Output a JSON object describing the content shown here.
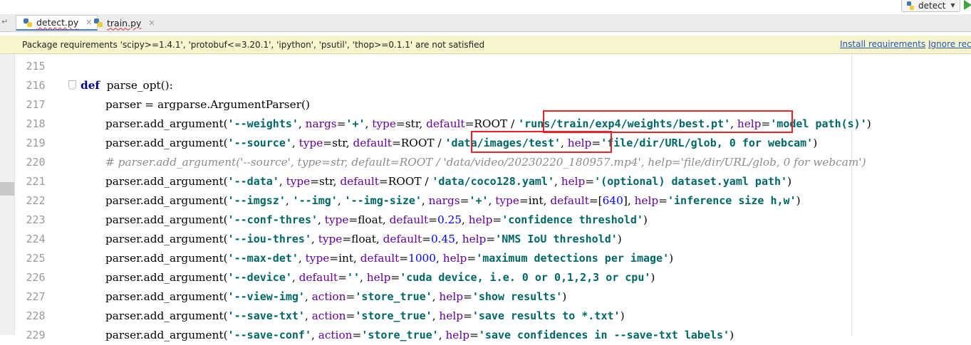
{
  "tabs": [
    {
      "label": "detect.py",
      "active": true
    },
    {
      "label": "train.py",
      "active": false
    }
  ],
  "tab_nav_icon": "tab-list-icon",
  "run_config": {
    "label": "detect",
    "icon": "python-file-icon"
  },
  "banner": {
    "message": "Package requirements 'scipy>=1.4.1', 'protobuf<=3.20.1', 'ipython', 'psutil', 'thop>=0.1.1' are not satisfied",
    "install_link": "Install requirements",
    "ignore_link": "Ignore rec"
  },
  "colors": {
    "keyword": "#000080",
    "string": "#006666",
    "kwarg": "#660099",
    "number": "#0000ff",
    "comment": "#8c8c8c",
    "highlight_box": "#e8232a",
    "banner_bg": "#f7f5cb"
  },
  "code_lines": [
    {
      "number": "215",
      "tokens": []
    },
    {
      "number": "216",
      "tokens": [
        [
          "kw",
          "def"
        ],
        [
          "",
          "  parse_opt():"
        ]
      ]
    },
    {
      "number": "217",
      "tokens": [
        [
          "",
          "    parser = argparse.ArgumentParser()"
        ]
      ]
    },
    {
      "number": "218",
      "tokens": [
        [
          "",
          "    parser.add_argument("
        ],
        [
          "str",
          "'--weights'"
        ],
        [
          "",
          ", "
        ],
        [
          "kwarg",
          "nargs"
        ],
        [
          "",
          "="
        ],
        [
          "str",
          "'+'"
        ],
        [
          "",
          ", "
        ],
        [
          "kwarg",
          "type"
        ],
        [
          "",
          "=str, "
        ],
        [
          "kwarg",
          "default"
        ],
        [
          "",
          "=ROOT / "
        ],
        [
          "str",
          "'runs/train/exp4/weights/best.pt'"
        ],
        [
          "",
          ", "
        ],
        [
          "kwarg",
          "help"
        ],
        [
          "",
          "="
        ],
        [
          "str",
          "'model path(s)'"
        ],
        [
          "",
          ")"
        ]
      ]
    },
    {
      "number": "219",
      "tokens": [
        [
          "",
          "    parser.add_argument("
        ],
        [
          "str",
          "'--source'"
        ],
        [
          "",
          ", "
        ],
        [
          "kwarg",
          "type"
        ],
        [
          "",
          "=str, "
        ],
        [
          "kwarg",
          "default"
        ],
        [
          "",
          "=ROOT / "
        ],
        [
          "str",
          "'data/images/test'"
        ],
        [
          "",
          ", "
        ],
        [
          "kwarg",
          "help"
        ],
        [
          "",
          "="
        ],
        [
          "str",
          "'file/dir/URL/glob, 0 for webcam'"
        ],
        [
          "",
          ")"
        ]
      ]
    },
    {
      "number": "220",
      "tokens": [
        [
          "",
          "    "
        ],
        [
          "cmt",
          "# parser.add_argument('--source', type=str, default=ROOT / 'data/video/20230220_180957.mp4', help='file/dir/URL/glob, 0 for webcam')"
        ]
      ]
    },
    {
      "number": "221",
      "tokens": [
        [
          "",
          "    parser.add_argument("
        ],
        [
          "str",
          "'--data'"
        ],
        [
          "",
          ", "
        ],
        [
          "kwarg",
          "type"
        ],
        [
          "",
          "=str, "
        ],
        [
          "kwarg",
          "default"
        ],
        [
          "",
          "=ROOT / "
        ],
        [
          "str",
          "'data/coco128.yaml'"
        ],
        [
          "",
          ", "
        ],
        [
          "kwarg",
          "help"
        ],
        [
          "",
          "="
        ],
        [
          "str",
          "'(optional) dataset.yaml path'"
        ],
        [
          "",
          ")"
        ]
      ]
    },
    {
      "number": "222",
      "tokens": [
        [
          "",
          "    parser.add_argument("
        ],
        [
          "str",
          "'--imgsz'"
        ],
        [
          "",
          ", "
        ],
        [
          "str",
          "'--img'"
        ],
        [
          "",
          ", "
        ],
        [
          "str",
          "'--img-size'"
        ],
        [
          "",
          ", "
        ],
        [
          "kwarg",
          "nargs"
        ],
        [
          "",
          "="
        ],
        [
          "str",
          "'+'"
        ],
        [
          "",
          ", "
        ],
        [
          "kwarg",
          "type"
        ],
        [
          "",
          "=int, "
        ],
        [
          "kwarg",
          "default"
        ],
        [
          "",
          "=["
        ],
        [
          "num",
          "640"
        ],
        [
          "",
          "], "
        ],
        [
          "kwarg",
          "help"
        ],
        [
          "",
          "="
        ],
        [
          "str",
          "'inference size h,w'"
        ],
        [
          "",
          ")"
        ]
      ]
    },
    {
      "number": "223",
      "tokens": [
        [
          "",
          "    parser.add_argument("
        ],
        [
          "str",
          "'--conf-thres'"
        ],
        [
          "",
          ", "
        ],
        [
          "kwarg",
          "type"
        ],
        [
          "",
          "=float, "
        ],
        [
          "kwarg",
          "default"
        ],
        [
          "",
          "="
        ],
        [
          "num",
          "0.25"
        ],
        [
          "",
          ", "
        ],
        [
          "kwarg",
          "help"
        ],
        [
          "",
          "="
        ],
        [
          "str",
          "'confidence threshold'"
        ],
        [
          "",
          ")"
        ]
      ]
    },
    {
      "number": "224",
      "tokens": [
        [
          "",
          "    parser.add_argument("
        ],
        [
          "str",
          "'--iou-thres'"
        ],
        [
          "",
          ", "
        ],
        [
          "kwarg",
          "type"
        ],
        [
          "",
          "=float, "
        ],
        [
          "kwarg",
          "default"
        ],
        [
          "",
          "="
        ],
        [
          "num",
          "0.45"
        ],
        [
          "",
          ", "
        ],
        [
          "kwarg",
          "help"
        ],
        [
          "",
          "="
        ],
        [
          "str",
          "'NMS IoU threshold'"
        ],
        [
          "",
          ")"
        ]
      ]
    },
    {
      "number": "225",
      "tokens": [
        [
          "",
          "    parser.add_argument("
        ],
        [
          "str",
          "'--max-det'"
        ],
        [
          "",
          ", "
        ],
        [
          "kwarg",
          "type"
        ],
        [
          "",
          "=int, "
        ],
        [
          "kwarg",
          "default"
        ],
        [
          "",
          "="
        ],
        [
          "num",
          "1000"
        ],
        [
          "",
          ", "
        ],
        [
          "kwarg",
          "help"
        ],
        [
          "",
          "="
        ],
        [
          "str",
          "'maximum detections per image'"
        ],
        [
          "",
          ")"
        ]
      ]
    },
    {
      "number": "226",
      "tokens": [
        [
          "",
          "    parser.add_argument("
        ],
        [
          "str",
          "'--device'"
        ],
        [
          "",
          ", "
        ],
        [
          "kwarg",
          "default"
        ],
        [
          "",
          "="
        ],
        [
          "str",
          "''"
        ],
        [
          "",
          ", "
        ],
        [
          "kwarg",
          "help"
        ],
        [
          "",
          "="
        ],
        [
          "str",
          "'cuda device, i.e. 0 or 0,1,2,3 or cpu'"
        ],
        [
          "",
          ")"
        ]
      ]
    },
    {
      "number": "227",
      "tokens": [
        [
          "",
          "    parser.add_argument("
        ],
        [
          "str",
          "'--view-img'"
        ],
        [
          "",
          ", "
        ],
        [
          "kwarg",
          "action"
        ],
        [
          "",
          "="
        ],
        [
          "str",
          "'store_true'"
        ],
        [
          "",
          ", "
        ],
        [
          "kwarg",
          "help"
        ],
        [
          "",
          "="
        ],
        [
          "str",
          "'show results'"
        ],
        [
          "",
          ")"
        ]
      ]
    },
    {
      "number": "228",
      "tokens": [
        [
          "",
          "    parser.add_argument("
        ],
        [
          "str",
          "'--save-txt'"
        ],
        [
          "",
          ", "
        ],
        [
          "kwarg",
          "action"
        ],
        [
          "",
          "="
        ],
        [
          "str",
          "'store_true'"
        ],
        [
          "",
          ", "
        ],
        [
          "kwarg",
          "help"
        ],
        [
          "",
          "="
        ],
        [
          "str",
          "'save results to *.txt'"
        ],
        [
          "",
          ")"
        ]
      ]
    },
    {
      "number": "229",
      "tokens": [
        [
          "",
          "    parser.add_argument("
        ],
        [
          "str",
          "'--save-conf'"
        ],
        [
          "",
          ", "
        ],
        [
          "kwarg",
          "action"
        ],
        [
          "",
          "="
        ],
        [
          "str",
          "'store_true'"
        ],
        [
          "",
          ", "
        ],
        [
          "kwarg",
          "help"
        ],
        [
          "",
          "="
        ],
        [
          "str",
          "'save confidences in --save-txt labels'"
        ],
        [
          "",
          ")"
        ]
      ]
    }
  ]
}
